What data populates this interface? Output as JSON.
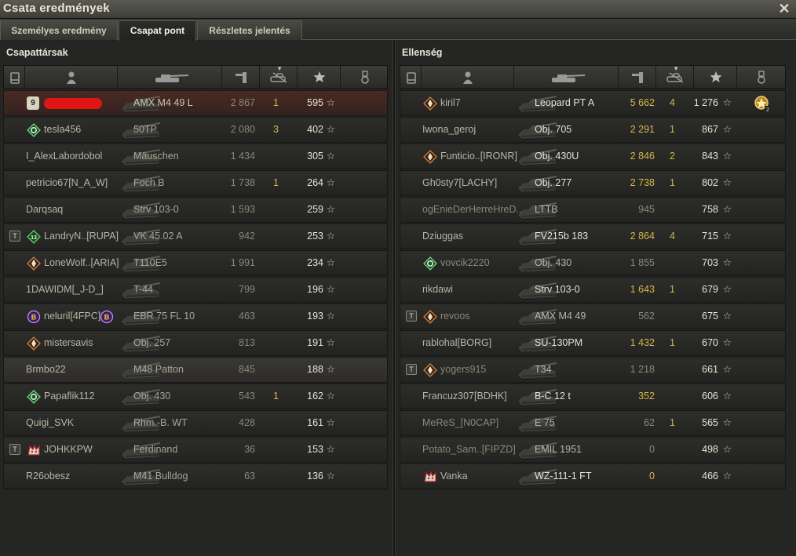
{
  "window": {
    "title": "Csata eredmények"
  },
  "tabs": [
    {
      "label": "Személyes eredmény",
      "active": false
    },
    {
      "label": "Csapat pont",
      "active": true
    },
    {
      "label": "Részletes jelentés",
      "active": false
    }
  ],
  "allies": {
    "title": "Csapattársak",
    "rows": [
      {
        "player": "",
        "tank": "AMX M4 49 L",
        "damage": "2 867",
        "kills": "1",
        "points": "595",
        "highlight": "me",
        "level": "9"
      },
      {
        "player": "tesla456",
        "tank": "50TP",
        "damage": "2 080",
        "kills": "3",
        "points": "402",
        "clan_icon": "green-diamond"
      },
      {
        "player": "I_AlexLabordobol",
        "tank": "Mäuschen",
        "damage": "1 434",
        "kills": "",
        "points": "305"
      },
      {
        "player": "petricio67[N_A_W]",
        "tank": "Foch B",
        "damage": "1 738",
        "kills": "1",
        "points": "264"
      },
      {
        "player": "Darqsaq",
        "tank": "Strv 103-0",
        "damage": "1 593",
        "kills": "",
        "points": "259"
      },
      {
        "player": "LandryN..[RUPA]",
        "tank": "VK 45.02 A",
        "damage": "942",
        "kills": "",
        "points": "253",
        "voice": true,
        "clan_icon": "green-13"
      },
      {
        "player": "LoneWolf..[ARIA]",
        "tank": "T110E5",
        "damage": "1 991",
        "kills": "",
        "points": "234",
        "clan_icon": "orange-diamond"
      },
      {
        "player": "1DAWIDM[_J-D_]",
        "tank": "T-44",
        "damage": "799",
        "kills": "",
        "points": "196"
      },
      {
        "player": "neluril[4FPC]",
        "tank": "EBR 75 FL 10",
        "damage": "463",
        "kills": "",
        "points": "193",
        "clan_icon": "purple-b",
        "purple": true
      },
      {
        "player": "mistersavis",
        "tank": "Obj. 257",
        "damage": "813",
        "kills": "",
        "points": "191",
        "clan_icon": "orange-diamond"
      },
      {
        "player": "Brmbo22",
        "tank": "M48 Patton",
        "damage": "845",
        "kills": "",
        "points": "188",
        "highlight": "sel"
      },
      {
        "player": "Papaflik112",
        "tank": "Obj. 430",
        "damage": "543",
        "kills": "1",
        "points": "162",
        "clan_icon": "green-diamond"
      },
      {
        "player": "Quigi_SVK",
        "tank": "Rhm.-B. WT",
        "damage": "428",
        "kills": "",
        "points": "161"
      },
      {
        "player": "JOHKKPW",
        "tank": "Ferdinand",
        "damage": "36",
        "kills": "",
        "points": "153",
        "voice": true,
        "clan_icon": "red-wolf"
      },
      {
        "player": "R26obesz",
        "tank": "M41 Bulldog",
        "damage": "63",
        "kills": "",
        "points": "136"
      }
    ]
  },
  "enemies": {
    "title": "Ellenség",
    "rows": [
      {
        "player": "kiril7",
        "tank": "Leopard PT A",
        "damage": "5 662",
        "kills": "4",
        "points": "1 276",
        "clan_icon": "orange-diamond",
        "alive": true,
        "medal": true
      },
      {
        "player": "Iwona_geroj",
        "tank": "Obj. 705",
        "damage": "2 291",
        "kills": "1",
        "points": "867",
        "alive": true
      },
      {
        "player": "Funticio..[IRONR]",
        "tank": "Obj. 430U",
        "damage": "2 846",
        "kills": "2",
        "points": "843",
        "clan_icon": "orange-diamond",
        "alive": true
      },
      {
        "player": "Gh0sty7[LACHY]",
        "tank": "Obj. 277",
        "damage": "2 738",
        "kills": "1",
        "points": "802",
        "alive": true
      },
      {
        "player": "ogEnieDerHerreHreD..",
        "tank": "LTTB",
        "damage": "945",
        "kills": "",
        "points": "758"
      },
      {
        "player": "Dziuggas",
        "tank": "FV215b 183",
        "damage": "2 864",
        "kills": "4",
        "points": "715",
        "alive": true
      },
      {
        "player": "vovcik2220",
        "tank": "Obj. 430",
        "damage": "1 855",
        "kills": "",
        "points": "703",
        "clan_icon": "green-diamond"
      },
      {
        "player": "rikdawi",
        "tank": "Strv 103-0",
        "damage": "1 643",
        "kills": "1",
        "points": "679",
        "alive": true
      },
      {
        "player": "revoos",
        "tank": "AMX M4 49",
        "damage": "562",
        "kills": "",
        "points": "675",
        "voice": true,
        "clan_icon": "orange-diamond"
      },
      {
        "player": "rablohal[BORG]",
        "tank": "SU-130PM",
        "damage": "1 432",
        "kills": "1",
        "points": "670",
        "alive": true
      },
      {
        "player": "yogers915",
        "tank": "T34",
        "damage": "1 218",
        "kills": "",
        "points": "661",
        "voice": true,
        "clan_icon": "orange-diamond"
      },
      {
        "player": "Francuz307[BDHK]",
        "tank": "B-C 12 t",
        "damage": "352",
        "kills": "",
        "points": "606",
        "alive": true
      },
      {
        "player": "MeReS_[N0CAP]",
        "tank": "E 75",
        "damage": "62",
        "kills": "1",
        "points": "565"
      },
      {
        "player": "Potato_Sam..[FIPZD]",
        "tank": "EMIL 1951",
        "damage": "0",
        "kills": "",
        "points": "498"
      },
      {
        "player": "Vanka",
        "tank": "WZ-111-1 FT",
        "damage": "0",
        "kills": "",
        "points": "466",
        "clan_icon": "red-wolf",
        "alive": true
      }
    ]
  },
  "icons": {
    "close": "close-icon",
    "columns": [
      "vehicle-class-icon",
      "player-icon",
      "tank-icon",
      "damage-icon",
      "kills-icon",
      "points-star-icon",
      "medal-icon"
    ]
  },
  "colors": {
    "accent_yellow": "#d7b64a",
    "self_red": "#e01616",
    "text": "#b8b6a6"
  }
}
